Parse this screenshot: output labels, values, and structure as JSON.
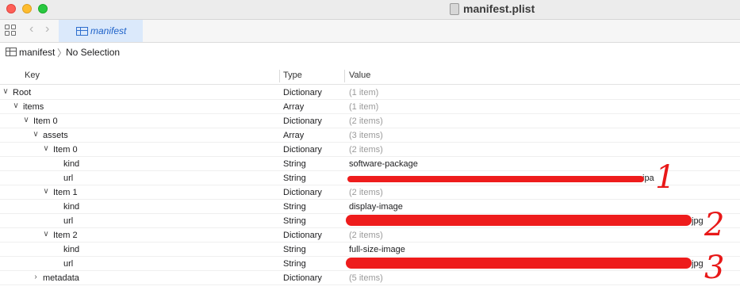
{
  "window": {
    "title": "manifest.plist"
  },
  "toolbar": {
    "tab_label": "manifest"
  },
  "pathbar": {
    "root": "manifest",
    "selection": "No Selection"
  },
  "columns": {
    "key": "Key",
    "type": "Type",
    "value": "Value"
  },
  "rows": [
    {
      "key": "Root",
      "type": "Dictionary",
      "value": "(1 item)"
    },
    {
      "key": "items",
      "type": "Array",
      "value": "(1 item)"
    },
    {
      "key": "Item 0",
      "type": "Dictionary",
      "value": "(2 items)"
    },
    {
      "key": "assets",
      "type": "Array",
      "value": "(3 items)"
    },
    {
      "key": "Item 0",
      "type": "Dictionary",
      "value": "(2 items)"
    },
    {
      "key": "kind",
      "type": "String",
      "value": "software-package"
    },
    {
      "key": "url",
      "type": "String",
      "value": "ipa"
    },
    {
      "key": "Item 1",
      "type": "Dictionary",
      "value": "(2 items)"
    },
    {
      "key": "kind",
      "type": "String",
      "value": "display-image"
    },
    {
      "key": "url",
      "type": "String",
      "value": "jpg"
    },
    {
      "key": "Item 2",
      "type": "Dictionary",
      "value": "(2 items)"
    },
    {
      "key": "kind",
      "type": "String",
      "value": "full-size-image"
    },
    {
      "key": "url",
      "type": "String",
      "value": "jpg"
    },
    {
      "key": "metadata",
      "type": "Dictionary",
      "value": "(5 items)"
    }
  ],
  "annotations": [
    "1",
    "2",
    "3"
  ],
  "colors": {
    "annotation_red": "#ee1c1c",
    "tab_blue": "#dbe9fb"
  }
}
